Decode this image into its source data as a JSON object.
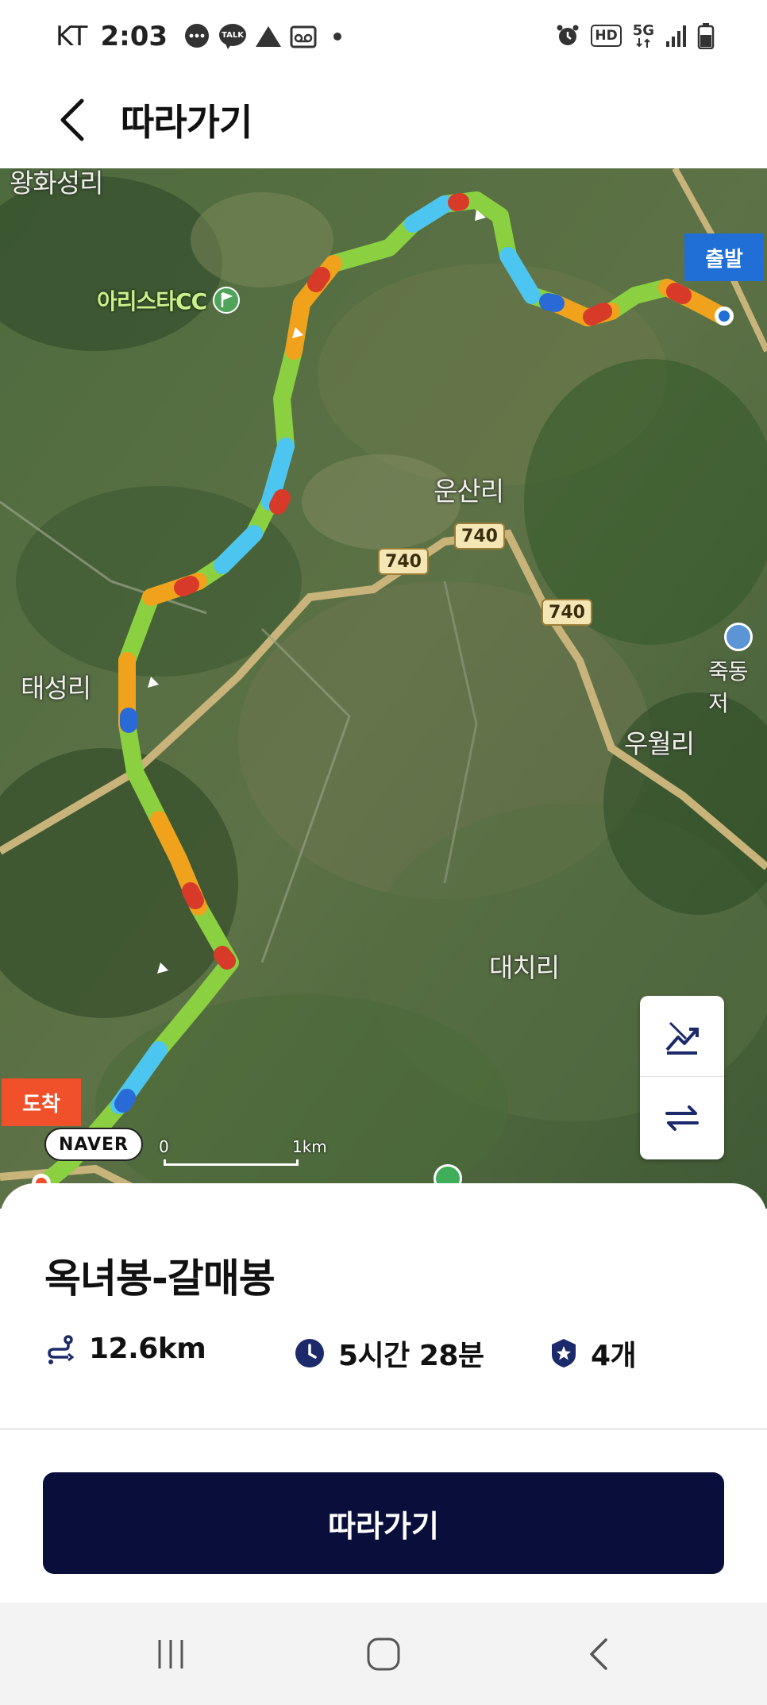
{
  "status_bar": {
    "carrier": "KT",
    "time": "2:03",
    "left_icons": [
      "message-bubble-icon",
      "kakaotalk-icon",
      "warning-triangle-icon",
      "voicemail-icon",
      "dot-icon"
    ],
    "right_icons": [
      "alarm-icon",
      "hd-icon",
      "5g-icon",
      "signal-icon",
      "battery-icon"
    ],
    "kakao_label": "TALK",
    "hd_label": "HD",
    "network_label": "5G"
  },
  "header": {
    "title": "따라가기"
  },
  "map": {
    "labels": {
      "wanghwaseongri": "왕화성리",
      "cc": "아리스타CC",
      "unsanri": "운산리",
      "taeseongri": "태성리",
      "jukdongje": "죽동저",
      "uwolri": "우월리",
      "daechiri": "대치리"
    },
    "road_numbers": [
      "740",
      "740",
      "740"
    ],
    "start_label": "출발",
    "end_label": "도착",
    "provider": "NAVER",
    "scale_zero": "0",
    "scale_one": "1km"
  },
  "course": {
    "title": "옥녀봉-갈매봉",
    "distance": "12.6km",
    "duration": "5시간 28분",
    "count": "4개"
  },
  "actions": {
    "follow_label": "따라가기"
  },
  "colors": {
    "primary_button": "#0a0e3a",
    "start_flag": "#1f6fd6",
    "end_flag": "#f0512a",
    "icon_navy": "#1c2a6b"
  }
}
